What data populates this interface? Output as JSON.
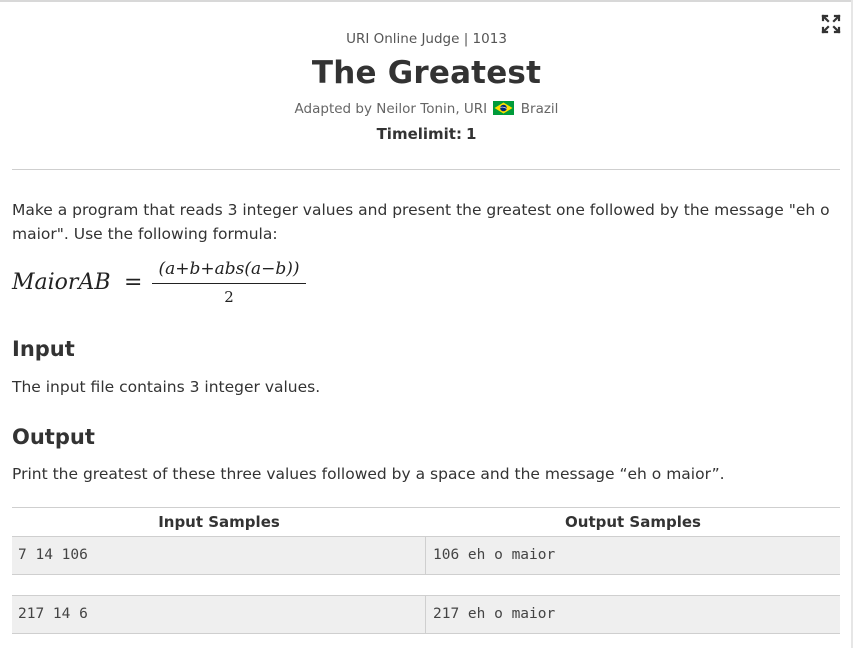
{
  "header": {
    "breadcrumb": "URI Online Judge | 1013",
    "title": "The Greatest",
    "adapted_by": "Adapted by Neilor Tonin, URI",
    "country": "Brazil",
    "timelimit_label": "Timelimit:",
    "timelimit_value": "1"
  },
  "toolbar": {
    "fullscreen_icon": "fullscreen-icon"
  },
  "description": {
    "text": "Make a program that reads 3 integer values and present the greatest one followed by the message \"eh o maior\". Use the following formula:",
    "formula_lhs": "MaiorAB",
    "formula_eq": "=",
    "formula_numerator": "(a+b+abs(a−b))",
    "formula_denominator": "2"
  },
  "input": {
    "heading": "Input",
    "text": "The input file contains 3 integer values."
  },
  "output": {
    "heading": "Output",
    "text": "Print the greatest of these three values followed by a space and the message “eh o maior”."
  },
  "samples": {
    "input_header": "Input Samples",
    "output_header": "Output Samples",
    "rows": [
      {
        "input": "7 14 106",
        "output": "106 eh o maior"
      },
      {
        "input": "217 14 6",
        "output": "217 eh o maior"
      }
    ]
  },
  "colors": {
    "text": "#333333",
    "rule": "#cfcfcf",
    "sample_bg": "#efefef",
    "flag_green": "#009b3a",
    "flag_yellow": "#fedf00",
    "flag_blue": "#002776"
  }
}
